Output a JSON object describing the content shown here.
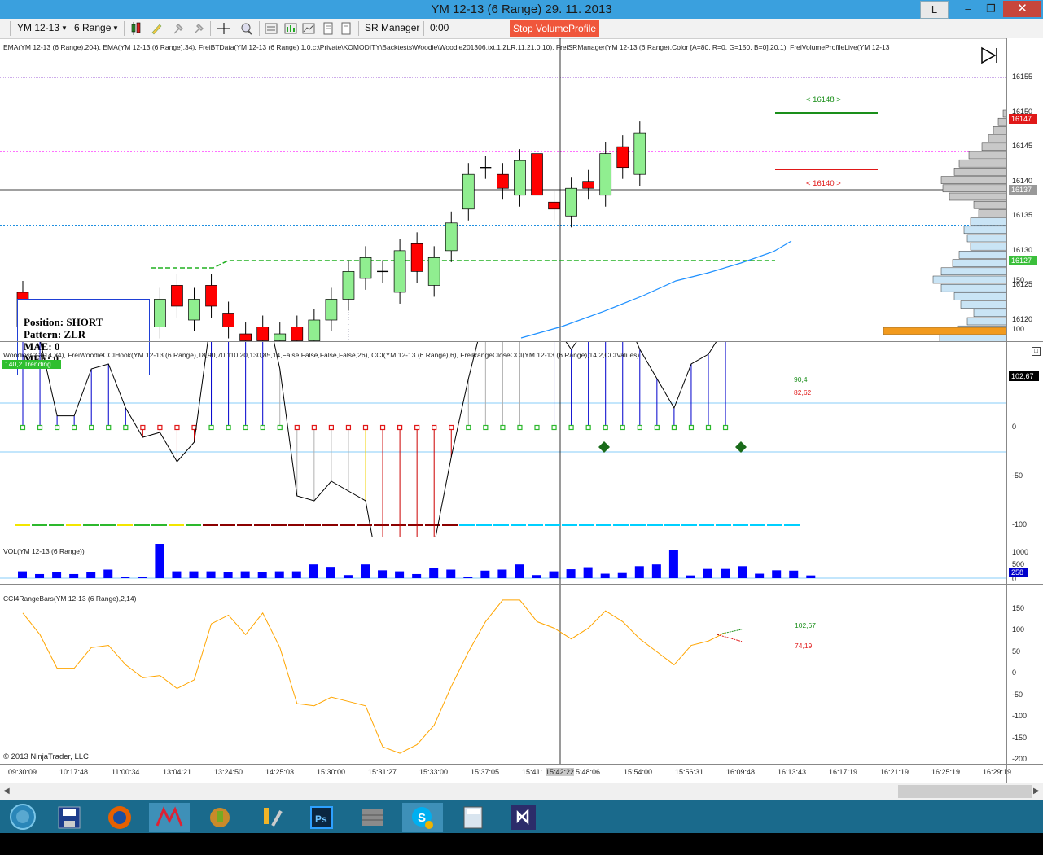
{
  "window": {
    "title": "YM 12-13 (6 Range)  29. 11. 2013",
    "btn_l": "L",
    "min": "–",
    "max": "❐",
    "close": "✕"
  },
  "toolbar": {
    "instrument": "YM 12-13",
    "period": "6 Range",
    "sr_manager": "SR Manager",
    "time": "0:00",
    "stop_vp": "Stop VolumeProfile"
  },
  "price_panel": {
    "indicator_text": "EMA(YM  12-13  (6  Range),204),  EMA(YM  12-13  (6  Range),34),  FreiBTData(YM  12-13  (6  Range),1,0,c:\\Private\\KOMODITY\\Backtests\\Woodie\\Woodie201306.txt,1,ZLR,11,21,0,10),  FreiSRManager(YM  12-13  (6  Range),Color  [A=80,  R=0,  G=150,  B=0],20,1),  FreiVolumeProfileLive(YM  12-13",
    "ticks": [
      "16155",
      "16150",
      "16145",
      "16140",
      "16135",
      "16130",
      "16125",
      "16120"
    ],
    "price_tag_red": "16147",
    "price_tag_gray": "16137",
    "price_tag_green": "16127",
    "sr_upper": "< 16148 >",
    "sr_lower": "< 16140 >",
    "info": {
      "position": "Position: SHORT",
      "pattern": "Pattern: ZLR",
      "mae": "MAE: 0",
      "mfe": "MFE: 0"
    }
  },
  "cci_panel": {
    "indicator_text": "WoodiesCCI(14,34),  FreiWoodieCCIHook(YM  12-13  (6  Range),18,90,70,110,20,130,85,14,False,False,False,False,26),  CCI(YM  12-13  (6  Range),6),  FreiRangeCloseCCI(YM  12-13  (6  Range),14,2,CCIValues)",
    "trending_badge": "140,2 Trending",
    "ticks": [
      "150",
      "100",
      "50",
      "0",
      "-50",
      "-100",
      "-150",
      "-200"
    ],
    "value_tag": "102,67",
    "hook_up": "90,4",
    "hook_down": "82,62"
  },
  "vol_panel": {
    "indicator_text": "VOL(YM 12-13 (6 Range))",
    "ticks": [
      "1000",
      "500",
      "0"
    ],
    "value_tag": "258"
  },
  "cci4_panel": {
    "indicator_text": "CCI4RangeBars(YM 12-13 (6 Range),2,14)",
    "ticks": [
      "150",
      "100",
      "50",
      "0",
      "-50",
      "-100",
      "-150",
      "-200"
    ],
    "up_value": "102,67",
    "down_value": "74,19"
  },
  "copyright": "© 2013 NinjaTrader, LLC",
  "time_axis": [
    "09:30:09",
    "10:17:48",
    "11:00:34",
    "13:04:21",
    "13:24:50",
    "14:25:03",
    "15:30:00",
    "15:31:27",
    "15:33:00",
    "15:37:05",
    "15:41:",
    "15:42:22",
    "5:48:06",
    "15:54:00",
    "15:56:31",
    "16:09:48",
    "16:13:43",
    "16:17:19",
    "16:21:19",
    "16:25:19",
    "16:29:19"
  ],
  "chart_data": {
    "type": "candlestick",
    "y_range": [
      16117,
      16157
    ],
    "bars": [
      {
        "o": 16124,
        "c": 16119,
        "dir": "down"
      },
      {
        "o": 16119,
        "c": 16117,
        "dir": "down"
      },
      {
        "o": 16117,
        "c": 16121,
        "dir": "up"
      },
      {
        "o": 16117,
        "c": 16121,
        "dir": "up"
      },
      {
        "o": 16121,
        "c": 16117,
        "dir": "down"
      },
      {
        "o": 16117,
        "c": 16119,
        "dir": "up"
      },
      {
        "o": 16120,
        "c": 16117,
        "dir": "down"
      },
      {
        "o": 16117,
        "c": 16119,
        "dir": "up"
      },
      {
        "o": 16119,
        "c": 16123,
        "dir": "up"
      },
      {
        "o": 16125,
        "c": 16122,
        "dir": "down"
      },
      {
        "o": 16120,
        "c": 16123,
        "dir": "up"
      },
      {
        "o": 16125,
        "c": 16122,
        "dir": "down"
      },
      {
        "o": 16121,
        "c": 16119,
        "dir": "down"
      },
      {
        "o": 16118,
        "c": 16117,
        "dir": "down"
      },
      {
        "o": 16119,
        "c": 16117,
        "dir": "down"
      },
      {
        "o": 16117,
        "c": 16118,
        "dir": "up"
      },
      {
        "o": 16119,
        "c": 16117,
        "dir": "down"
      },
      {
        "o": 16117,
        "c": 16120,
        "dir": "up"
      },
      {
        "o": 16120,
        "c": 16123,
        "dir": "up"
      },
      {
        "o": 16123,
        "c": 16127,
        "dir": "up"
      },
      {
        "o": 16126,
        "c": 16129,
        "dir": "up"
      },
      {
        "o": 16127,
        "c": 16127,
        "dir": "flat"
      },
      {
        "o": 16124,
        "c": 16130,
        "dir": "up"
      },
      {
        "o": 16131,
        "c": 16127,
        "dir": "down"
      },
      {
        "o": 16125,
        "c": 16129,
        "dir": "up"
      },
      {
        "o": 16130,
        "c": 16134,
        "dir": "up"
      },
      {
        "o": 16136,
        "c": 16141,
        "dir": "up"
      },
      {
        "o": 16142,
        "c": 16142,
        "dir": "flat"
      },
      {
        "o": 16141,
        "c": 16139,
        "dir": "down"
      },
      {
        "o": 16138,
        "c": 16143,
        "dir": "up"
      },
      {
        "o": 16144,
        "c": 16138,
        "dir": "down"
      },
      {
        "o": 16137,
        "c": 16136,
        "dir": "down"
      },
      {
        "o": 16135,
        "c": 16139,
        "dir": "up"
      },
      {
        "o": 16140,
        "c": 16139,
        "dir": "down"
      },
      {
        "o": 16138,
        "c": 16144,
        "dir": "up"
      },
      {
        "o": 16145,
        "c": 16142,
        "dir": "down"
      },
      {
        "o": 16141,
        "c": 16147,
        "dir": "up"
      }
    ],
    "cci": [
      140,
      90,
      12,
      12,
      60,
      65,
      20,
      -10,
      -5,
      -35,
      -15,
      115,
      135,
      90,
      140,
      60,
      -70,
      -75,
      -55,
      -65,
      -75,
      -170,
      -185,
      -165,
      -120,
      -30,
      50,
      120,
      170,
      170,
      120,
      105,
      80,
      105,
      145,
      120,
      80,
      50,
      20,
      65,
      75,
      102.67
    ],
    "volume": [
      200,
      120,
      180,
      120,
      180,
      250,
      30,
      40,
      1000,
      200,
      200,
      200,
      180,
      200,
      170,
      200,
      200,
      400,
      330,
      90,
      400,
      230,
      200,
      120,
      300,
      250,
      30,
      220,
      250,
      400,
      90,
      200,
      260,
      320,
      130,
      150,
      350,
      400,
      820,
      80,
      270,
      270,
      350,
      130,
      230,
      220,
      80,
      320,
      320,
      300,
      160,
      270,
      230
    ],
    "cci4": [
      140,
      90,
      12,
      12,
      60,
      65,
      20,
      -10,
      -5,
      -35,
      -15,
      115,
      135,
      90,
      140,
      60,
      -70,
      -75,
      -55,
      -65,
      -75,
      -170,
      -185,
      -165,
      -120,
      -30,
      50,
      120,
      170,
      170,
      120,
      105,
      80,
      105,
      145,
      120,
      80,
      50,
      20,
      65,
      75,
      95
    ],
    "colors": {
      "up": "#90ee90",
      "down": "#ff0000",
      "ema34": "#1e90ff",
      "cci_line": "#000000",
      "cci4_line": "#ffa500",
      "profile_gray": "#c8c8c8",
      "profile_blue": "#c9e4f5",
      "profile_poc": "#f29a1d",
      "vol_bar": "#0000ff"
    }
  }
}
